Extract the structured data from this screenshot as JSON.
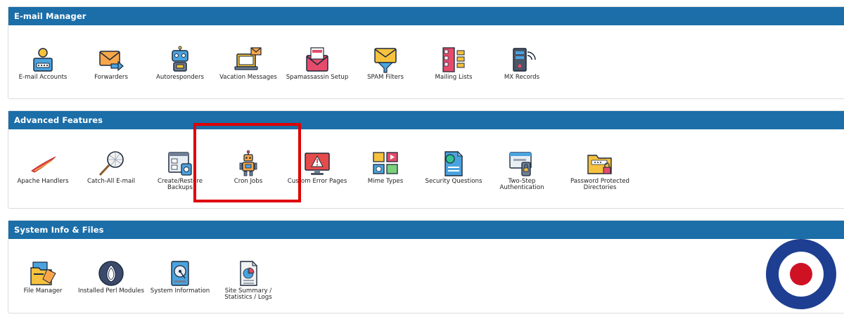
{
  "sections": [
    {
      "title": "E-mail Manager",
      "items": [
        {
          "label": "E-mail Accounts"
        },
        {
          "label": "Forwarders"
        },
        {
          "label": "Autoresponders"
        },
        {
          "label": "Vacation Messages"
        },
        {
          "label": "Spamassassin Setup"
        },
        {
          "label": "SPAM Filters"
        },
        {
          "label": "Mailing Lists"
        },
        {
          "label": "MX Records"
        }
      ]
    },
    {
      "title": "Advanced Features",
      "items": [
        {
          "label": "Apache Handlers"
        },
        {
          "label": "Catch-All E-mail"
        },
        {
          "label": "Create/Restore Backups"
        },
        {
          "label": "Cron Jobs"
        },
        {
          "label": "Custom Error Pages"
        },
        {
          "label": "Mime Types"
        },
        {
          "label": "Security Questions"
        },
        {
          "label": "Two-Step Authentication"
        },
        {
          "label": "Password Protected Directories"
        }
      ]
    },
    {
      "title": "System Info & Files",
      "items": [
        {
          "label": "File Manager"
        },
        {
          "label": "Installed Perl Modules"
        },
        {
          "label": "System Information"
        },
        {
          "label": "Site Summary / Statistics / Logs"
        }
      ]
    }
  ],
  "colors": {
    "header": "#1b6ea8",
    "highlight": "#e00000",
    "roundel_blue": "#1e3f91",
    "roundel_red": "#cf1124"
  }
}
